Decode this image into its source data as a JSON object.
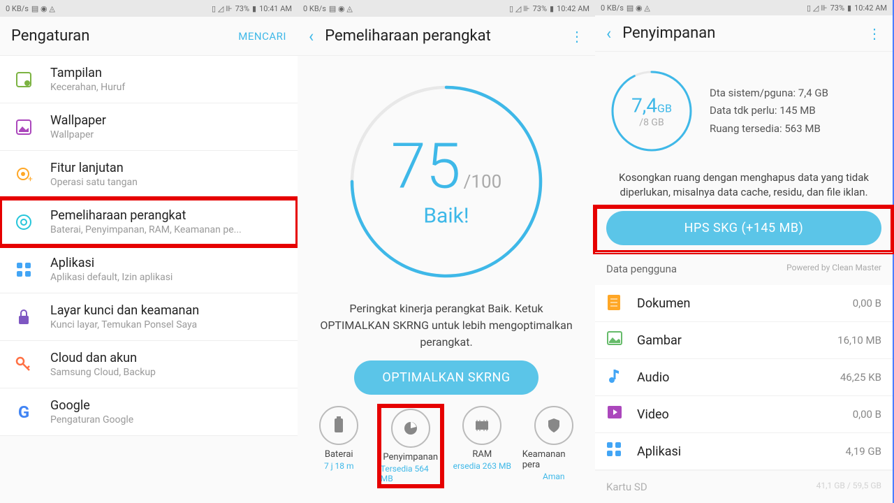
{
  "status": {
    "net": "0 KB/s",
    "signal": "73%",
    "time1": "10:41 AM",
    "time2": "10:42 AM"
  },
  "p1": {
    "title": "Pengaturan",
    "search": "MENCARI",
    "items": [
      {
        "title": "Tampilan",
        "sub": "Kecerahan, Huruf"
      },
      {
        "title": "Wallpaper",
        "sub": "Wallpaper"
      },
      {
        "title": "Fitur lanjutan",
        "sub": "Operasi satu tangan"
      },
      {
        "title": "Pemeliharaan perangkat",
        "sub": "Baterai, Penyimpanan, RAM, Keamanan pe..."
      },
      {
        "title": "Aplikasi",
        "sub": "Aplikasi default, Izin aplikasi"
      },
      {
        "title": "Layar kunci dan keamanan",
        "sub": "Kunci layar, Temukan Ponsel Saya"
      },
      {
        "title": "Cloud dan akun",
        "sub": "Samsung Cloud, Backup"
      },
      {
        "title": "Google",
        "sub": "Pengaturan Google"
      }
    ]
  },
  "p2": {
    "title": "Pemeliharaan perangkat",
    "score": "75",
    "max": "/100",
    "label": "Baik!",
    "desc": "Peringkat kinerja perangkat Baik. Ketuk OPTIMALKAN SKRNG untuk lebih mengoptimalkan perangkat.",
    "btn": "OPTIMALKAN SKRNG",
    "nav": [
      {
        "label": "Baterai",
        "sub": "7 j 18 m"
      },
      {
        "label": "Penyimpanan",
        "sub": "Tersedia 564 MB"
      },
      {
        "label": "RAM",
        "sub": "ersedia 263 MB"
      },
      {
        "label": "Keamanan pera",
        "sub": "Aman"
      }
    ]
  },
  "p3": {
    "title": "Penyimpanan",
    "used": "7,4",
    "gb": "GB",
    "total": "/8 GB",
    "stats": [
      "Dta sistem/pguna: 7,4 GB",
      "Data tdk perlu: 145 MB",
      "Ruang tersedia: 563 MB"
    ],
    "msg": "Kosongkan ruang dengan menghapus data yang tidak diperlukan, misalnya data cache, residu, dan file iklan.",
    "btn": "HPS SKG (+145 MB)",
    "section": "Data pengguna",
    "powered": "Powered by Clean Master",
    "items": [
      {
        "label": "Dokumen",
        "val": "0,00 B"
      },
      {
        "label": "Gambar",
        "val": "16,10 MB"
      },
      {
        "label": "Audio",
        "val": "46,25 KB"
      },
      {
        "label": "Video",
        "val": "0,00 B"
      },
      {
        "label": "Aplikasi",
        "val": "4,19 GB"
      }
    ],
    "sd": "Kartu SD",
    "sdval": "41,1 GB / 59,5 GB"
  }
}
